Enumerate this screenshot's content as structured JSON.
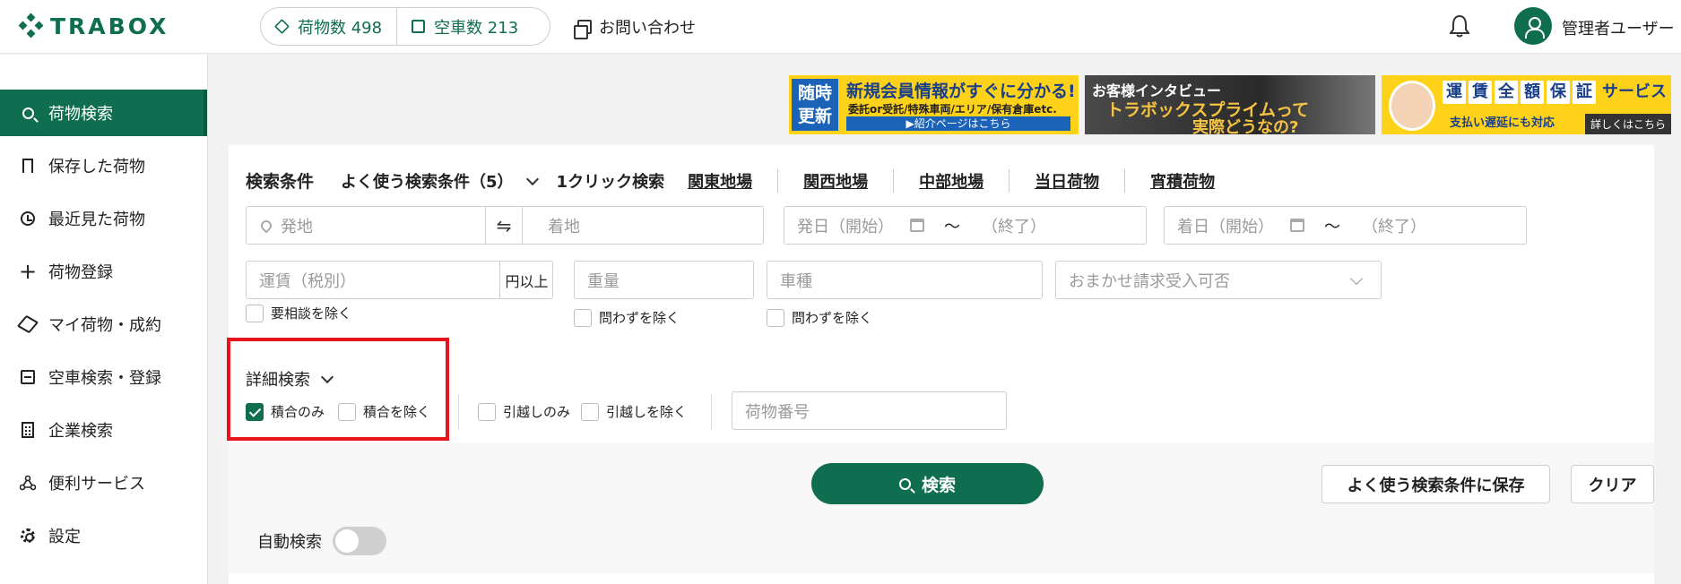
{
  "header": {
    "logo": "TRABOX",
    "cargo_count_label": "荷物数 498",
    "vacant_count_label": "空車数 213",
    "contact_label": "お問い合わせ",
    "user_name": "管理者ユーザー"
  },
  "sidebar": {
    "items": [
      {
        "label": "荷物検索",
        "icon": "search-icon"
      },
      {
        "label": "保存した荷物",
        "icon": "bookmark-icon"
      },
      {
        "label": "最近見た荷物",
        "icon": "clock-icon"
      },
      {
        "label": "荷物登録",
        "icon": "plus-icon"
      },
      {
        "label": "マイ荷物・成約",
        "icon": "box-icon"
      },
      {
        "label": "空車検索・登録",
        "icon": "truck-icon"
      },
      {
        "label": "企業検索",
        "icon": "building-icon"
      },
      {
        "label": "便利サービス",
        "icon": "network-icon"
      },
      {
        "label": "設定",
        "icon": "gear-icon"
      }
    ]
  },
  "banners": {
    "b1_badge": "随時更新",
    "b1_title": "新規会員情報がすぐに分かる!",
    "b1_sub": "委託or受託/特殊車両/エリア/保有倉庫etc.",
    "b1_link": "▶紹介ページはこちら",
    "b2_top": "お客様インタビュー",
    "b2_mid": "トラボックスプライムって",
    "b2_bot": "実際どうなの?",
    "b3_chars": [
      "運",
      "賃",
      "全",
      "額",
      "保",
      "証"
    ],
    "b3_suffix": "サービス",
    "b3_sub": "支払い遅延にも対応",
    "b3_more": "詳しくはこちら"
  },
  "search": {
    "title": "検索条件",
    "favorite": "よく使う検索条件（5）",
    "one_click": "1クリック検索",
    "quick_links": [
      "関東地場",
      "関西地場",
      "中部地場",
      "当日荷物",
      "宵積荷物"
    ],
    "origin_placeholder": "発地",
    "dest_placeholder": "着地",
    "swap_symbol": "⇋",
    "dep_start": "発日（開始）",
    "dep_end": "（終了）",
    "arr_start": "着日（開始）",
    "arr_end": "（終了）",
    "tilde": "〜",
    "fare_placeholder": "運賃（税別）",
    "fare_unit": "円以上",
    "weight_placeholder": "重量",
    "vehicle_placeholder": "車種",
    "omakase_placeholder": "おまかせ請求受入可否",
    "exclude_negotiation": "要相談を除く",
    "weight_exclude": "問わずを除く",
    "vehicle_exclude": "問わずを除く",
    "detail_label": "詳細検索",
    "consolidated_only": "積合のみ",
    "exclude_consolidated": "積合を除く",
    "moving_only": "引越しのみ",
    "exclude_moving": "引越しを除く",
    "cargo_number_placeholder": "荷物番号",
    "search_button": "検索",
    "save_button": "よく使う検索条件に保存",
    "clear_button": "クリア",
    "auto_search": "自動検索"
  },
  "state": {
    "consolidated_only_checked": true,
    "auto_search_on": false
  },
  "colors": {
    "brand_green": "#0e6e4f",
    "highlight_red": "#e8141b"
  }
}
